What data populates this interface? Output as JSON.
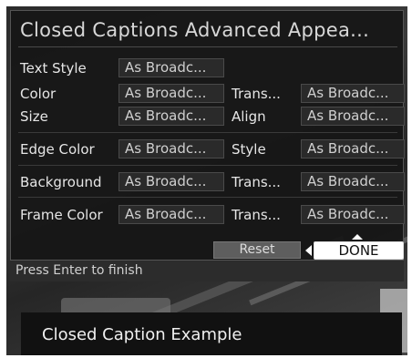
{
  "title": "Closed Captions Advanced Appea...",
  "rows": {
    "text_style": {
      "label": "Text Style",
      "value": "As Broadc..."
    },
    "color": {
      "label": "Color",
      "value": "As Broadc...",
      "trans_label": "Trans...",
      "trans_value": "As Broadc..."
    },
    "size": {
      "label": "Size",
      "value": "As Broadc...",
      "align_label": "Align",
      "align_value": "As Broadc..."
    },
    "edge_color": {
      "label": "Edge Color",
      "value": "As Broadc...",
      "style_label": "Style",
      "style_value": "As Broadc..."
    },
    "background": {
      "label": "Background",
      "value": "As Broadc...",
      "trans_label": "Trans...",
      "trans_value": "As Broadc..."
    },
    "frame_color": {
      "label": "Frame Color",
      "value": "As Broadc...",
      "trans_label": "Trans...",
      "trans_value": "As Broadc..."
    }
  },
  "buttons": {
    "reset": "Reset",
    "done": "DONE"
  },
  "status": "Press Enter to finish",
  "caption_example": "Closed Caption Example"
}
